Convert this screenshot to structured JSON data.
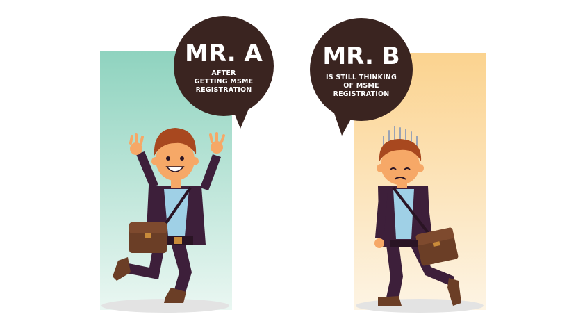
{
  "panels": {
    "left": {
      "title": "MR. A",
      "line1": "AFTER",
      "line2": "GETTING MSME",
      "line3": "REGISTRATION",
      "bg_top": "#8fd3bf",
      "bg_bottom": "#e8f6f1"
    },
    "right": {
      "title": "MR. B",
      "line1": "IS STILL THINKING",
      "line2": "OF MSME",
      "line3": "REGISTRATION",
      "bg_top": "#fbd38f",
      "bg_bottom": "#fdf3e2"
    }
  },
  "colors": {
    "bubble": "#3a2420",
    "suit": "#3d1f3a",
    "hair": "#a8481f",
    "skin": "#f6a867",
    "shirt": "#9fd0e6",
    "bag": "#6b3e26",
    "shadow": "#e6e6e6"
  },
  "icons": {
    "left_character": "happy-jumping-man-icon",
    "right_character": "worried-thinking-man-icon"
  }
}
